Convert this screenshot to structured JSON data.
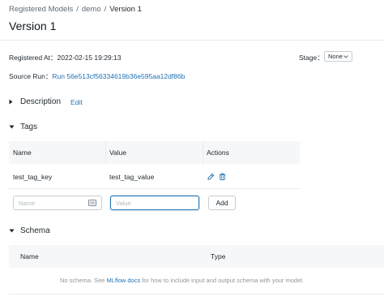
{
  "breadcrumb": {
    "items": [
      "Registered Models",
      "demo"
    ],
    "separator": "/",
    "current": "Version 1"
  },
  "page_title": "Version 1",
  "metadata": {
    "registered_at_label": "Registered At：",
    "registered_at_value": "2022-02-15 19:29:13",
    "stage_label": "Stage：",
    "stage_value": "None",
    "source_run_label": "Source Run：",
    "source_run_value": "Run 56e513cf56334619b36e595aa12df86b"
  },
  "description": {
    "title": "Description",
    "edit_label": "Edit"
  },
  "tags": {
    "title": "Tags",
    "columns": [
      "Name",
      "Value",
      "Actions"
    ],
    "rows": [
      {
        "name": "test_tag_key",
        "value": "test_tag_value"
      }
    ],
    "name_placeholder": "Name",
    "value_placeholder": "Value",
    "add_label": "Add"
  },
  "schema": {
    "title": "Schema",
    "columns": [
      "Name",
      "Type"
    ],
    "empty_prefix": "No schema. See ",
    "empty_link": "MLflow docs",
    "empty_suffix": " for how to include input and output schema with your model."
  },
  "colors": {
    "accent": "#2272b4",
    "text": "#1f272d",
    "muted": "#8f979d",
    "table_header_bg": "#f6f7f8"
  },
  "icons": [
    "caret-right-icon",
    "caret-down-icon",
    "calendar-icon",
    "edit-icon",
    "delete-icon",
    "chevron-down-icon"
  ]
}
